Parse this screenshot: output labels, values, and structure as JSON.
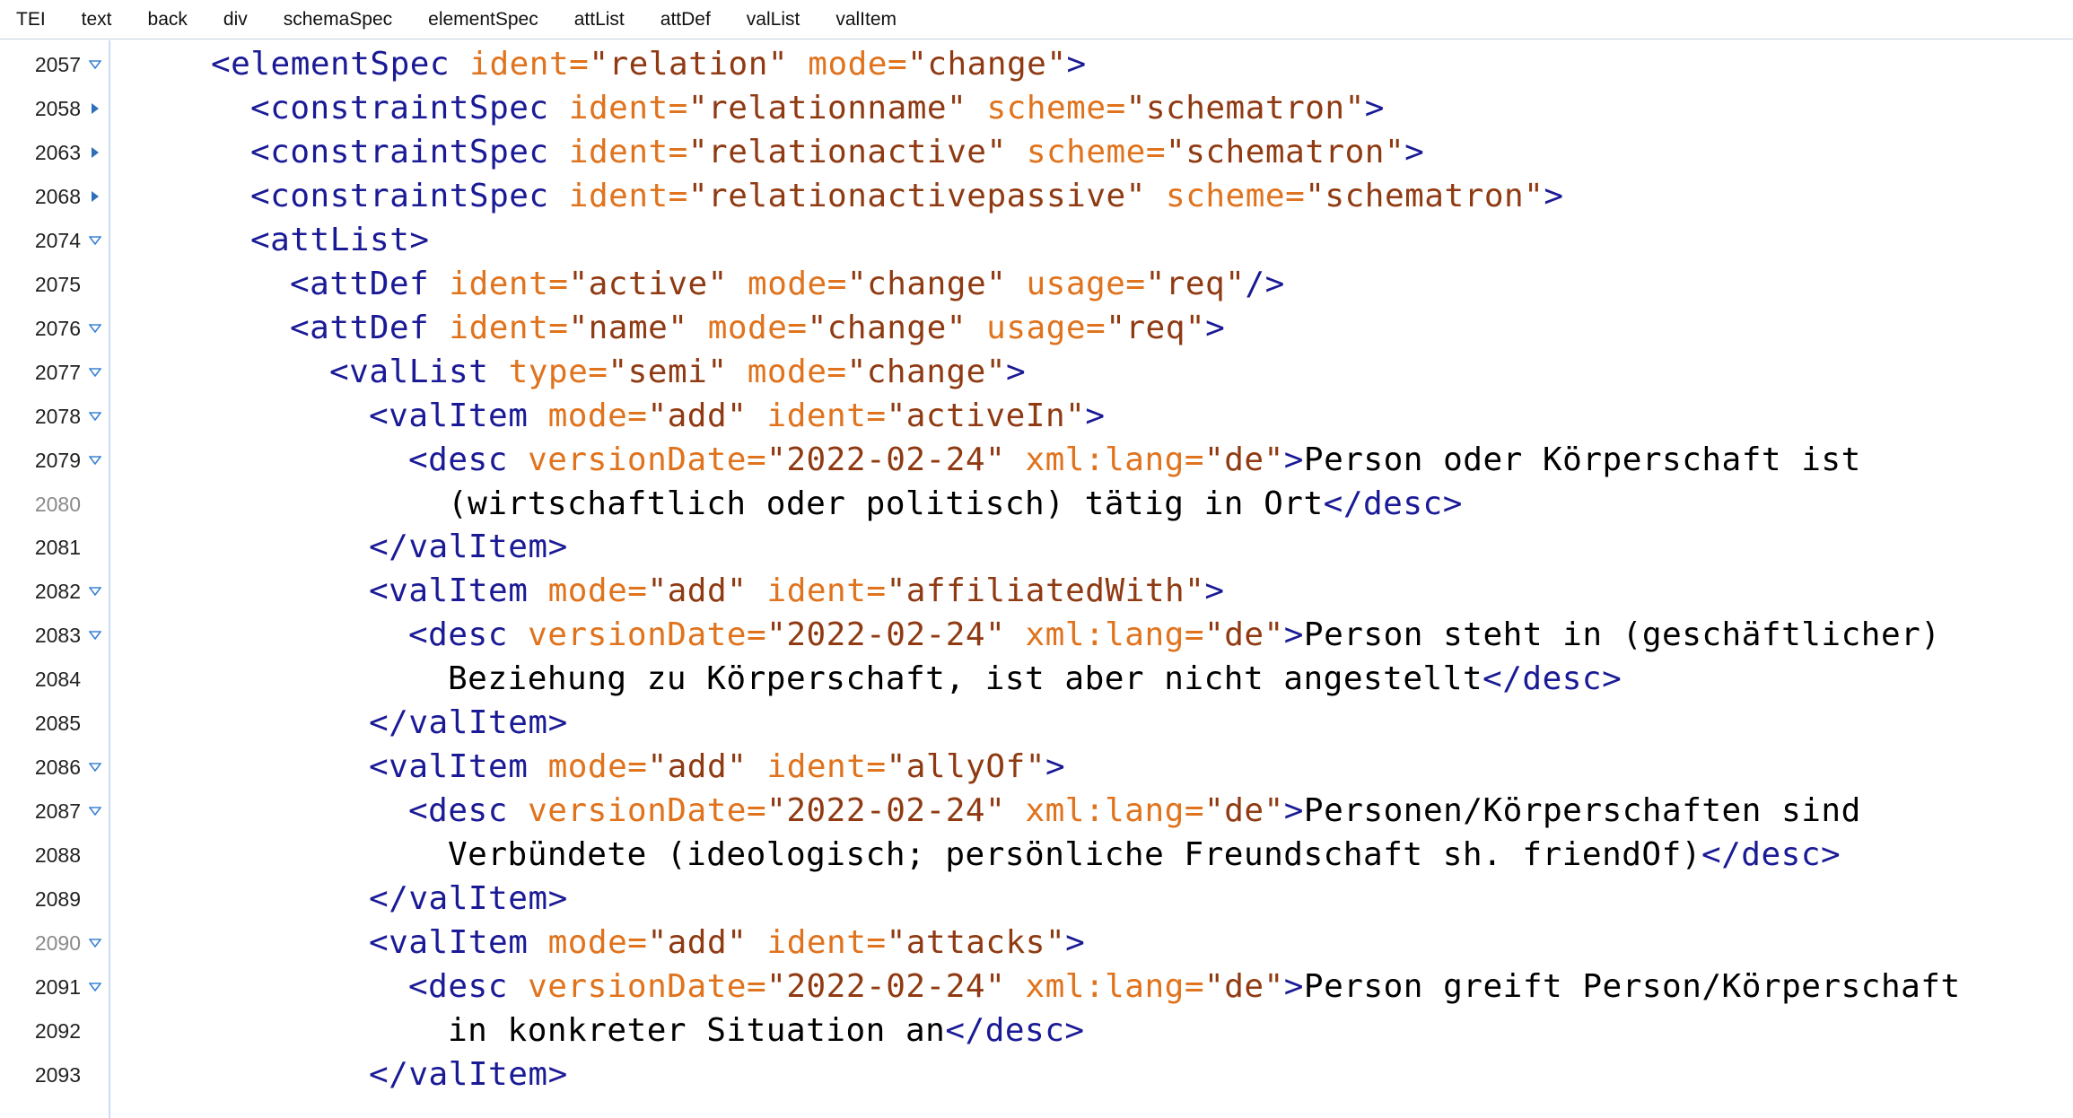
{
  "breadcrumb": [
    "TEI",
    "text",
    "back",
    "div",
    "schemaSpec",
    "elementSpec",
    "attList",
    "attDef",
    "valList",
    "valItem"
  ],
  "colors": {
    "tag": "#1a1a96",
    "attribute_name": "#e0731d",
    "attribute_value": "#8f3a12",
    "text": "#000000",
    "fold_icon": "#3b83d6",
    "gutter_border": "#c9dcf2"
  },
  "lines": [
    {
      "num": "2057",
      "fold": "expanded",
      "indent": 0,
      "segments": [
        {
          "c": "t",
          "s": "<elementSpec"
        },
        {
          "c": "x",
          "s": " "
        },
        {
          "c": "a",
          "s": "ident="
        },
        {
          "c": "v",
          "s": "\"relation\""
        },
        {
          "c": "x",
          "s": " "
        },
        {
          "c": "a",
          "s": "mode="
        },
        {
          "c": "v",
          "s": "\"change\""
        },
        {
          "c": "t",
          "s": ">"
        }
      ]
    },
    {
      "num": "2058",
      "fold": "collapsed",
      "indent": 1,
      "segments": [
        {
          "c": "t",
          "s": "<constraintSpec"
        },
        {
          "c": "x",
          "s": " "
        },
        {
          "c": "a",
          "s": "ident="
        },
        {
          "c": "v",
          "s": "\"relationname\""
        },
        {
          "c": "x",
          "s": " "
        },
        {
          "c": "a",
          "s": "scheme="
        },
        {
          "c": "v",
          "s": "\"schematron\""
        },
        {
          "c": "t",
          "s": ">"
        }
      ]
    },
    {
      "num": "2063",
      "fold": "collapsed",
      "indent": 1,
      "segments": [
        {
          "c": "t",
          "s": "<constraintSpec"
        },
        {
          "c": "x",
          "s": " "
        },
        {
          "c": "a",
          "s": "ident="
        },
        {
          "c": "v",
          "s": "\"relationactive\""
        },
        {
          "c": "x",
          "s": " "
        },
        {
          "c": "a",
          "s": "scheme="
        },
        {
          "c": "v",
          "s": "\"schematron\""
        },
        {
          "c": "t",
          "s": ">"
        }
      ]
    },
    {
      "num": "2068",
      "fold": "collapsed",
      "indent": 1,
      "segments": [
        {
          "c": "t",
          "s": "<constraintSpec"
        },
        {
          "c": "x",
          "s": " "
        },
        {
          "c": "a",
          "s": "ident="
        },
        {
          "c": "v",
          "s": "\"relationactivepassive\""
        },
        {
          "c": "x",
          "s": " "
        },
        {
          "c": "a",
          "s": "scheme="
        },
        {
          "c": "v",
          "s": "\"schematron\""
        },
        {
          "c": "t",
          "s": ">"
        }
      ]
    },
    {
      "num": "2074",
      "fold": "expanded",
      "indent": 1,
      "segments": [
        {
          "c": "t",
          "s": "<attList>"
        }
      ]
    },
    {
      "num": "2075",
      "fold": "none",
      "indent": 2,
      "segments": [
        {
          "c": "t",
          "s": "<attDef"
        },
        {
          "c": "x",
          "s": " "
        },
        {
          "c": "a",
          "s": "ident="
        },
        {
          "c": "v",
          "s": "\"active\""
        },
        {
          "c": "x",
          "s": " "
        },
        {
          "c": "a",
          "s": "mode="
        },
        {
          "c": "v",
          "s": "\"change\""
        },
        {
          "c": "x",
          "s": " "
        },
        {
          "c": "a",
          "s": "usage="
        },
        {
          "c": "v",
          "s": "\"req\""
        },
        {
          "c": "t",
          "s": "/>"
        }
      ]
    },
    {
      "num": "2076",
      "fold": "expanded",
      "indent": 2,
      "segments": [
        {
          "c": "t",
          "s": "<attDef"
        },
        {
          "c": "x",
          "s": " "
        },
        {
          "c": "a",
          "s": "ident="
        },
        {
          "c": "v",
          "s": "\"name\""
        },
        {
          "c": "x",
          "s": " "
        },
        {
          "c": "a",
          "s": "mode="
        },
        {
          "c": "v",
          "s": "\"change\""
        },
        {
          "c": "x",
          "s": " "
        },
        {
          "c": "a",
          "s": "usage="
        },
        {
          "c": "v",
          "s": "\"req\""
        },
        {
          "c": "t",
          "s": ">"
        }
      ]
    },
    {
      "num": "2077",
      "fold": "expanded",
      "indent": 3,
      "segments": [
        {
          "c": "t",
          "s": "<valList"
        },
        {
          "c": "x",
          "s": " "
        },
        {
          "c": "a",
          "s": "type="
        },
        {
          "c": "v",
          "s": "\"semi\""
        },
        {
          "c": "x",
          "s": " "
        },
        {
          "c": "a",
          "s": "mode="
        },
        {
          "c": "v",
          "s": "\"change\""
        },
        {
          "c": "t",
          "s": ">"
        }
      ]
    },
    {
      "num": "2078",
      "fold": "expanded",
      "indent": 4,
      "segments": [
        {
          "c": "t",
          "s": "<valItem"
        },
        {
          "c": "x",
          "s": " "
        },
        {
          "c": "a",
          "s": "mode="
        },
        {
          "c": "v",
          "s": "\"add\""
        },
        {
          "c": "x",
          "s": " "
        },
        {
          "c": "a",
          "s": "ident="
        },
        {
          "c": "v",
          "s": "\"activeIn\""
        },
        {
          "c": "t",
          "s": ">"
        }
      ]
    },
    {
      "num": "2079",
      "fold": "expanded",
      "indent": 5,
      "segments": [
        {
          "c": "t",
          "s": "<desc"
        },
        {
          "c": "x",
          "s": " "
        },
        {
          "c": "a",
          "s": "versionDate="
        },
        {
          "c": "v",
          "s": "\"2022-02-24\""
        },
        {
          "c": "x",
          "s": " "
        },
        {
          "c": "a",
          "s": "xml:lang="
        },
        {
          "c": "v",
          "s": "\"de\""
        },
        {
          "c": "t",
          "s": ">"
        },
        {
          "c": "x",
          "s": "Person oder Körperschaft ist"
        }
      ]
    },
    {
      "num": "2080",
      "fold": "none",
      "dim": true,
      "indent": 6,
      "segments": [
        {
          "c": "x",
          "s": "(wirtschaftlich oder politisch) tätig in Ort"
        },
        {
          "c": "t",
          "s": "</desc>"
        }
      ]
    },
    {
      "num": "2081",
      "fold": "none",
      "indent": 4,
      "segments": [
        {
          "c": "t",
          "s": "</valItem>"
        }
      ]
    },
    {
      "num": "2082",
      "fold": "expanded",
      "indent": 4,
      "segments": [
        {
          "c": "t",
          "s": "<valItem"
        },
        {
          "c": "x",
          "s": " "
        },
        {
          "c": "a",
          "s": "mode="
        },
        {
          "c": "v",
          "s": "\"add\""
        },
        {
          "c": "x",
          "s": " "
        },
        {
          "c": "a",
          "s": "ident="
        },
        {
          "c": "v",
          "s": "\"affiliatedWith\""
        },
        {
          "c": "t",
          "s": ">"
        }
      ]
    },
    {
      "num": "2083",
      "fold": "expanded",
      "indent": 5,
      "segments": [
        {
          "c": "t",
          "s": "<desc"
        },
        {
          "c": "x",
          "s": " "
        },
        {
          "c": "a",
          "s": "versionDate="
        },
        {
          "c": "v",
          "s": "\"2022-02-24\""
        },
        {
          "c": "x",
          "s": " "
        },
        {
          "c": "a",
          "s": "xml:lang="
        },
        {
          "c": "v",
          "s": "\"de\""
        },
        {
          "c": "t",
          "s": ">"
        },
        {
          "c": "x",
          "s": "Person steht in (geschäftlicher)"
        }
      ]
    },
    {
      "num": "2084",
      "fold": "none",
      "indent": 6,
      "segments": [
        {
          "c": "x",
          "s": "Beziehung zu Körperschaft, ist aber nicht angestellt"
        },
        {
          "c": "t",
          "s": "</desc>"
        }
      ]
    },
    {
      "num": "2085",
      "fold": "none",
      "indent": 4,
      "segments": [
        {
          "c": "t",
          "s": "</valItem>"
        }
      ]
    },
    {
      "num": "2086",
      "fold": "expanded",
      "indent": 4,
      "segments": [
        {
          "c": "t",
          "s": "<valItem"
        },
        {
          "c": "x",
          "s": " "
        },
        {
          "c": "a",
          "s": "mode="
        },
        {
          "c": "v",
          "s": "\"add\""
        },
        {
          "c": "x",
          "s": " "
        },
        {
          "c": "a",
          "s": "ident="
        },
        {
          "c": "v",
          "s": "\"allyOf\""
        },
        {
          "c": "t",
          "s": ">"
        }
      ]
    },
    {
      "num": "2087",
      "fold": "expanded",
      "indent": 5,
      "segments": [
        {
          "c": "t",
          "s": "<desc"
        },
        {
          "c": "x",
          "s": " "
        },
        {
          "c": "a",
          "s": "versionDate="
        },
        {
          "c": "v",
          "s": "\"2022-02-24\""
        },
        {
          "c": "x",
          "s": " "
        },
        {
          "c": "a",
          "s": "xml:lang="
        },
        {
          "c": "v",
          "s": "\"de\""
        },
        {
          "c": "t",
          "s": ">"
        },
        {
          "c": "x",
          "s": "Personen/Körperschaften sind"
        }
      ]
    },
    {
      "num": "2088",
      "fold": "none",
      "indent": 6,
      "segments": [
        {
          "c": "x",
          "s": "Verbündete (ideologisch; persönliche Freundschaft sh. friendOf)"
        },
        {
          "c": "t",
          "s": "</desc>"
        }
      ]
    },
    {
      "num": "2089",
      "fold": "none",
      "indent": 4,
      "segments": [
        {
          "c": "t",
          "s": "</valItem>"
        }
      ]
    },
    {
      "num": "2090",
      "fold": "expanded",
      "dim": true,
      "indent": 4,
      "segments": [
        {
          "c": "t",
          "s": "<valItem"
        },
        {
          "c": "x",
          "s": " "
        },
        {
          "c": "a",
          "s": "mode="
        },
        {
          "c": "v",
          "s": "\"add\""
        },
        {
          "c": "x",
          "s": " "
        },
        {
          "c": "a",
          "s": "ident="
        },
        {
          "c": "v",
          "s": "\"attacks\""
        },
        {
          "c": "t",
          "s": ">"
        }
      ]
    },
    {
      "num": "2091",
      "fold": "expanded",
      "indent": 5,
      "segments": [
        {
          "c": "t",
          "s": "<desc"
        },
        {
          "c": "x",
          "s": " "
        },
        {
          "c": "a",
          "s": "versionDate="
        },
        {
          "c": "v",
          "s": "\"2022-02-24\""
        },
        {
          "c": "x",
          "s": " "
        },
        {
          "c": "a",
          "s": "xml:lang="
        },
        {
          "c": "v",
          "s": "\"de\""
        },
        {
          "c": "t",
          "s": ">"
        },
        {
          "c": "x",
          "s": "Person greift Person/Körperschaft"
        }
      ]
    },
    {
      "num": "2092",
      "fold": "none",
      "indent": 6,
      "segments": [
        {
          "c": "x",
          "s": "in konkreter Situation an"
        },
        {
          "c": "t",
          "s": "</desc>"
        }
      ]
    },
    {
      "num": "2093",
      "fold": "none",
      "indent": 4,
      "segments": [
        {
          "c": "t",
          "s": "</valItem>"
        }
      ]
    }
  ]
}
